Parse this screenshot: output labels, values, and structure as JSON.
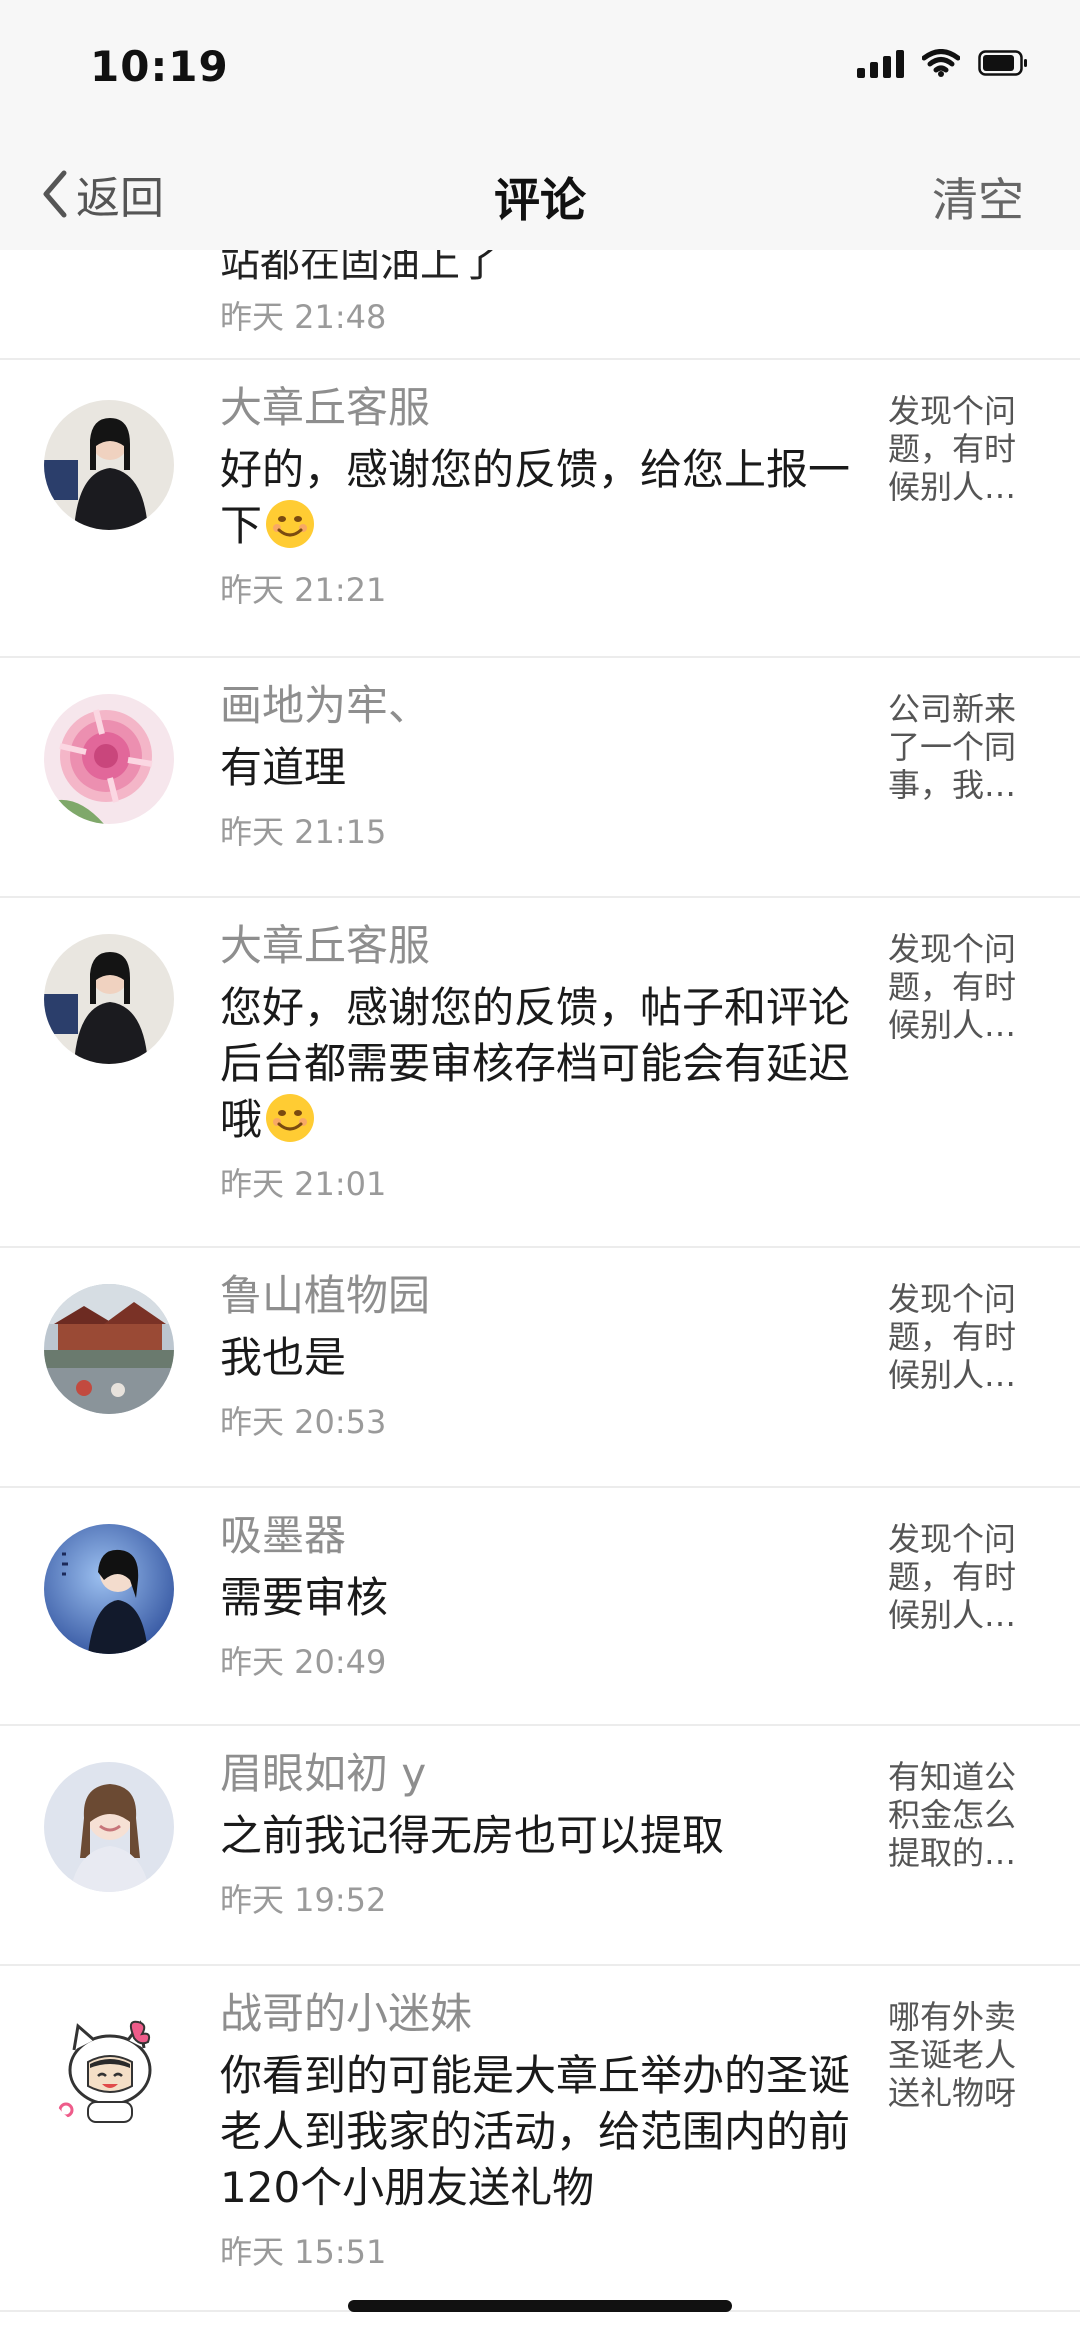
{
  "status": {
    "time": "10:19"
  },
  "nav": {
    "back_label": "返回",
    "title": "评论",
    "clear_label": "清空"
  },
  "partial": {
    "text": "站都在固油上了",
    "time": "昨天 21:48"
  },
  "comments": [
    {
      "user": "大章丘客服",
      "text": "好的，感谢您的反馈，给您上报一下",
      "has_emoji": true,
      "time": "昨天 21:21",
      "side": "发现个问题，有时候别人…"
    },
    {
      "user": "画地为牢、",
      "text": "有道理",
      "has_emoji": false,
      "time": "昨天 21:15",
      "side": "公司新来了一个同事，我…"
    },
    {
      "user": "大章丘客服",
      "text": "您好，感谢您的反馈，帖子和评论后台都需要审核存档可能会有延迟哦",
      "has_emoji": true,
      "time": "昨天 21:01",
      "side": "发现个问题，有时候别人…"
    },
    {
      "user": "鲁山植物园",
      "text": "我也是",
      "has_emoji": false,
      "time": "昨天 20:53",
      "side": "发现个问题，有时候别人…"
    },
    {
      "user": "吸墨器",
      "text": "需要审核",
      "has_emoji": false,
      "time": "昨天 20:49",
      "side": "发现个问题，有时候别人…"
    },
    {
      "user": "眉眼如初 y",
      "text": "之前我记得无房也可以提取",
      "has_emoji": false,
      "time": "昨天 19:52",
      "side": "有知道公积金怎么提取的…"
    },
    {
      "user": "战哥的小迷妹",
      "text": "你看到的可能是大章丘举办的圣诞老人到我家的活动，给范围内的前120个小朋友送礼物",
      "has_emoji": false,
      "time": "昨天 15:51",
      "side": "哪有外卖圣诞老人送礼物呀"
    }
  ],
  "colors": {
    "topbar_bg": "#f7f7f7",
    "username": "#8e8e8e",
    "time": "#9a9a9a",
    "divider": "#ececec"
  },
  "icons": [
    "cellular-signal-icon",
    "wifi-icon",
    "battery-icon",
    "chevron-left-icon",
    "smile-emoji-icon"
  ]
}
